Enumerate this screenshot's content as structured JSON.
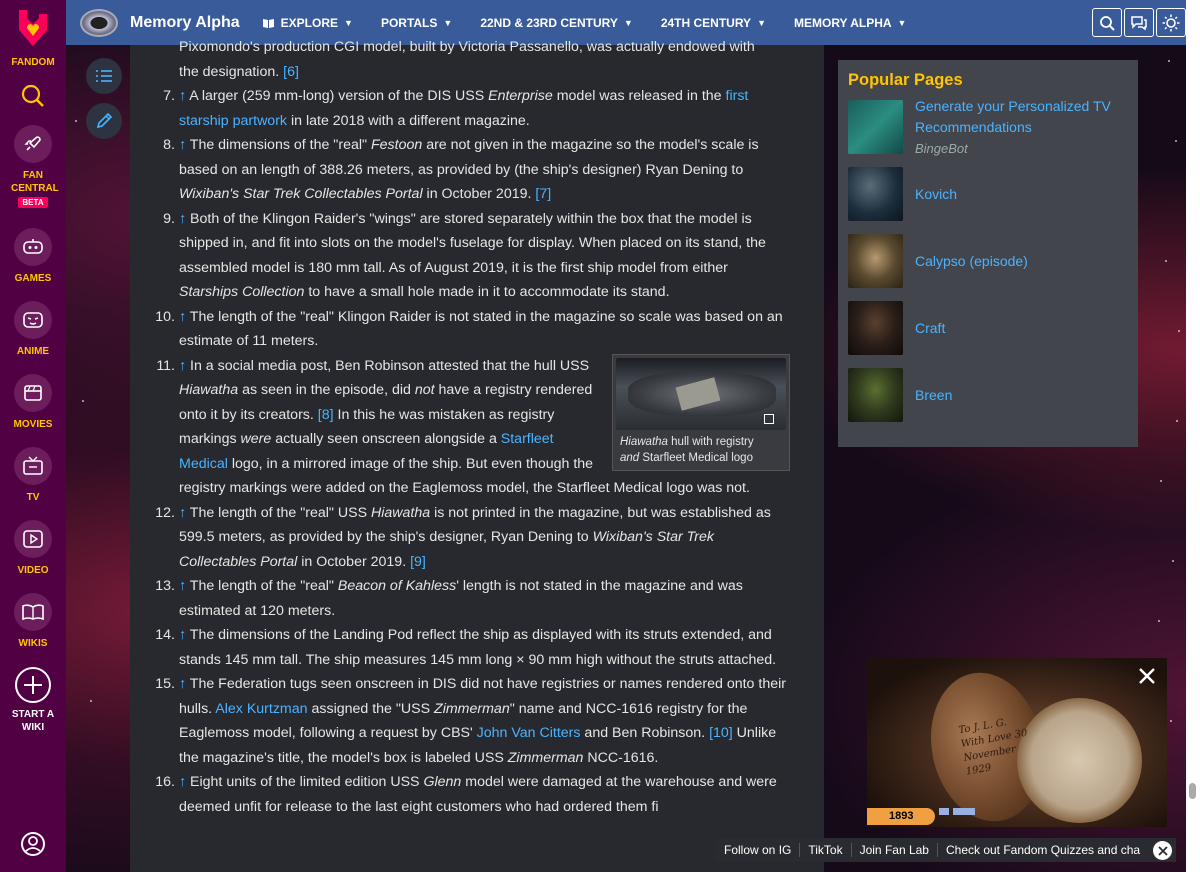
{
  "rail": {
    "fandom_label": "FANDOM",
    "items": [
      {
        "label": "FAN CENTRAL",
        "badge": "BETA",
        "icon": "rocket-icon"
      },
      {
        "label": "GAMES",
        "icon": "gamepad-icon"
      },
      {
        "label": "ANIME",
        "icon": "anime-face-icon"
      },
      {
        "label": "MOVIES",
        "icon": "clapperboard-icon"
      },
      {
        "label": "TV",
        "icon": "tv-icon"
      },
      {
        "label": "VIDEO",
        "icon": "play-icon"
      },
      {
        "label": "WIKIS",
        "icon": "book-icon"
      },
      {
        "label": "START A WIKI",
        "icon": "plus-circle-icon"
      }
    ]
  },
  "nav": {
    "wiki_name": "Memory Alpha",
    "items": [
      {
        "label": "EXPLORE"
      },
      {
        "label": "PORTALS"
      },
      {
        "label": "22ND & 23RD CENTURY"
      },
      {
        "label": "24TH CENTURY"
      },
      {
        "label": "MEMORY ALPHA"
      }
    ]
  },
  "article": {
    "top_clipped": "Pixomondo's production CGI model, built by Victoria Passanello, was actually endowed with",
    "notes": [
      {
        "num": "7.",
        "parts": [
          {
            "t": "↑",
            "link": true
          },
          {
            "t": " A larger (259 mm-long) version of the DIS USS "
          },
          {
            "t": "Enterprise",
            "i": true
          },
          {
            "t": " model was released in the "
          },
          {
            "t": "first starship partwork",
            "link": true
          },
          {
            "t": " in late 2018 with a different magazine."
          }
        ]
      },
      {
        "num": "8.",
        "parts": [
          {
            "t": "↑",
            "link": true
          },
          {
            "t": " The dimensions of the \"real\" "
          },
          {
            "t": "Festoon",
            "i": true
          },
          {
            "t": " are not given in the magazine so the model's scale is based on an length of 388.26 meters, as provided by (the ship's designer) Ryan Dening to "
          },
          {
            "t": "Wixiban's Star Trek Collectables Portal",
            "i": true
          },
          {
            "t": " in October 2019. "
          },
          {
            "t": "[7]",
            "link": true
          }
        ]
      },
      {
        "num": "9.",
        "parts": [
          {
            "t": "↑",
            "link": true
          },
          {
            "t": " Both of the Klingon Raider's \"wings\" are stored separately within the box that the model is shipped in, and fit into slots on the model's fuselage for display. When placed on its stand, the assembled model is 180 mm tall. As of August 2019, it is the first ship model from either "
          },
          {
            "t": "Starships Collection",
            "i": true
          },
          {
            "t": " to have a small hole made in it to accommodate its stand."
          }
        ]
      },
      {
        "num": "10.",
        "parts": [
          {
            "t": "↑",
            "link": true
          },
          {
            "t": " The length of the \"real\" Klingon Raider is not stated in the magazine so scale was based on an estimate of 11 meters."
          }
        ]
      },
      {
        "num": "11.",
        "thumb": true,
        "parts": [
          {
            "t": "↑",
            "link": true
          },
          {
            "t": " In a social media post, Ben Robinson attested that the hull USS "
          },
          {
            "t": "Hiawatha",
            "i": true
          },
          {
            "t": " as seen in the episode, did "
          },
          {
            "t": "not",
            "i": true
          },
          {
            "t": " have a registry rendered onto it by its creators. "
          },
          {
            "t": "[8]",
            "link": true
          },
          {
            "t": " In this he was mistaken as registry markings "
          },
          {
            "t": "were",
            "i": true
          },
          {
            "t": " actually seen onscreen alongside a "
          },
          {
            "t": "Starfleet Medical",
            "link": true
          },
          {
            "t": " logo, in a mirrored image of the ship. But even though the registry markings were added on the Eaglemoss model, the Starfleet Medical logo was not."
          }
        ]
      },
      {
        "num": "12.",
        "parts": [
          {
            "t": "↑",
            "link": true
          },
          {
            "t": " The length of the \"real\" USS "
          },
          {
            "t": "Hiawatha",
            "i": true
          },
          {
            "t": " is not printed in the magazine, but was established as 599.5 meters, as provided by the ship's designer, Ryan Dening to "
          },
          {
            "t": "Wixiban's Star Trek Collectables Portal",
            "i": true
          },
          {
            "t": " in October 2019. "
          },
          {
            "t": "[9]",
            "link": true
          }
        ]
      },
      {
        "num": "13.",
        "parts": [
          {
            "t": "↑",
            "link": true
          },
          {
            "t": " The length of the \"real\" "
          },
          {
            "t": "Beacon of Kahless",
            "i": true
          },
          {
            "t": "' length is not stated in the magazine and was estimated at 120 meters."
          }
        ]
      },
      {
        "num": "14.",
        "parts": [
          {
            "t": "↑",
            "link": true
          },
          {
            "t": " The dimensions of the Landing Pod reflect the ship as displayed with its struts extended, and stands 145 mm tall. The ship measures 145 mm long × 90 mm high without the struts attached."
          }
        ]
      },
      {
        "num": "15.",
        "parts": [
          {
            "t": "↑",
            "link": true
          },
          {
            "t": " The Federation tugs seen onscreen in DIS did not have registries or names rendered onto their hulls. "
          },
          {
            "t": "Alex Kurtzman",
            "link": true
          },
          {
            "t": " assigned the \"USS "
          },
          {
            "t": "Zimmerman",
            "i": true
          },
          {
            "t": "\" name and NCC-1616 registry for the Eaglemoss model, following a request by CBS' "
          },
          {
            "t": "John Van Citters",
            "link": true
          },
          {
            "t": " and Ben Robinson. "
          },
          {
            "t": "[10]",
            "link": true
          },
          {
            "t": " Unlike the magazine's title, the model's box is labeled USS "
          },
          {
            "t": "Zimmerman",
            "i": true
          },
          {
            "t": " NCC-1616."
          }
        ]
      },
      {
        "num": "16.",
        "parts": [
          {
            "t": "↑",
            "link": true
          },
          {
            "t": " Eight units of the limited edition USS "
          },
          {
            "t": "Glenn",
            "i": true
          },
          {
            "t": " model were damaged at the warehouse and were deemed unfit for release to the last eight customers who had ordered them fi"
          }
        ]
      }
    ],
    "thumb": {
      "caption_italic": "Hiawatha",
      "caption_rest": " hull with registry",
      "caption_italic2": "and",
      "caption_rest2": " Starfleet Medical logo"
    }
  },
  "popular": {
    "title": "Popular Pages",
    "items": [
      {
        "label": "Generate your Personalized TV Recommendations",
        "sub": "BingeBot",
        "thumb_color": "#1f6f6a"
      },
      {
        "label": "Kovich",
        "thumb_color": "#1d2e3d"
      },
      {
        "label": "Calypso (episode)",
        "thumb_color": "#5a4a30"
      },
      {
        "label": "Craft",
        "thumb_color": "#2a1e18"
      },
      {
        "label": "Breen",
        "thumb_color": "#2f3a1e"
      }
    ]
  },
  "video": {
    "lcars_number": "1893",
    "watch_text": "To J. L. G. With Love 30 November 1929"
  },
  "social": {
    "items": [
      "Follow on IG",
      "TikTok",
      "Join Fan Lab",
      "Check out Fandom Quizzes and cha"
    ]
  },
  "colors": {
    "rail": "#520044",
    "nav": "#3a5b99",
    "accent_yellow": "#ffc500",
    "link": "#4ab3ff",
    "content_bg": "#28292e"
  }
}
